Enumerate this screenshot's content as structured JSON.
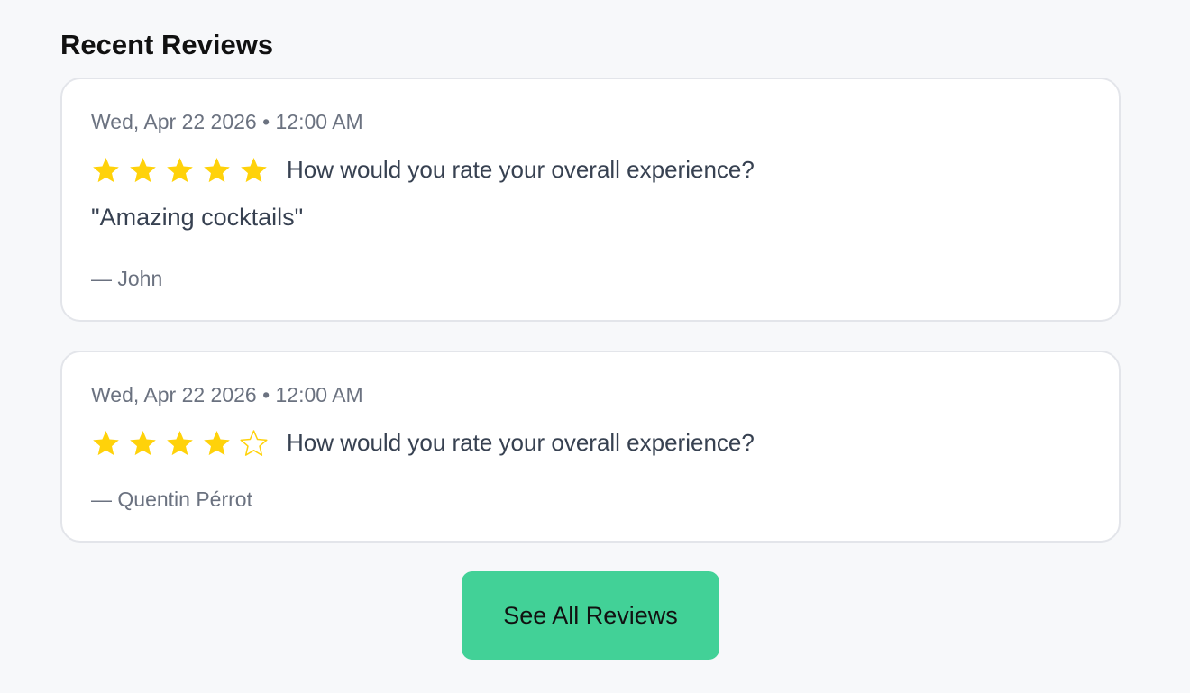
{
  "section": {
    "title": "Recent Reviews"
  },
  "reviews": [
    {
      "date": "Wed, Apr 22 2026 • 12:00 AM",
      "rating": 5,
      "rating_max": 5,
      "question": "How would you rate your overall experience?",
      "comment": "\"Amazing cocktails\"",
      "author": "— John"
    },
    {
      "date": "Wed, Apr 22 2026 • 12:00 AM",
      "rating": 4,
      "rating_max": 5,
      "question": "How would you rate your overall experience?",
      "author": "— Quentin Pérrot"
    }
  ],
  "see_all_button": {
    "label": "See All Reviews"
  },
  "colors": {
    "star_filled": "#ffd20a",
    "star_empty_outline": "#ffd20a",
    "button_bg": "#42d197",
    "page_bg": "#f7f8fa"
  },
  "icons": {
    "filled_star": "star-filled-icon",
    "empty_star": "star-empty-icon"
  }
}
